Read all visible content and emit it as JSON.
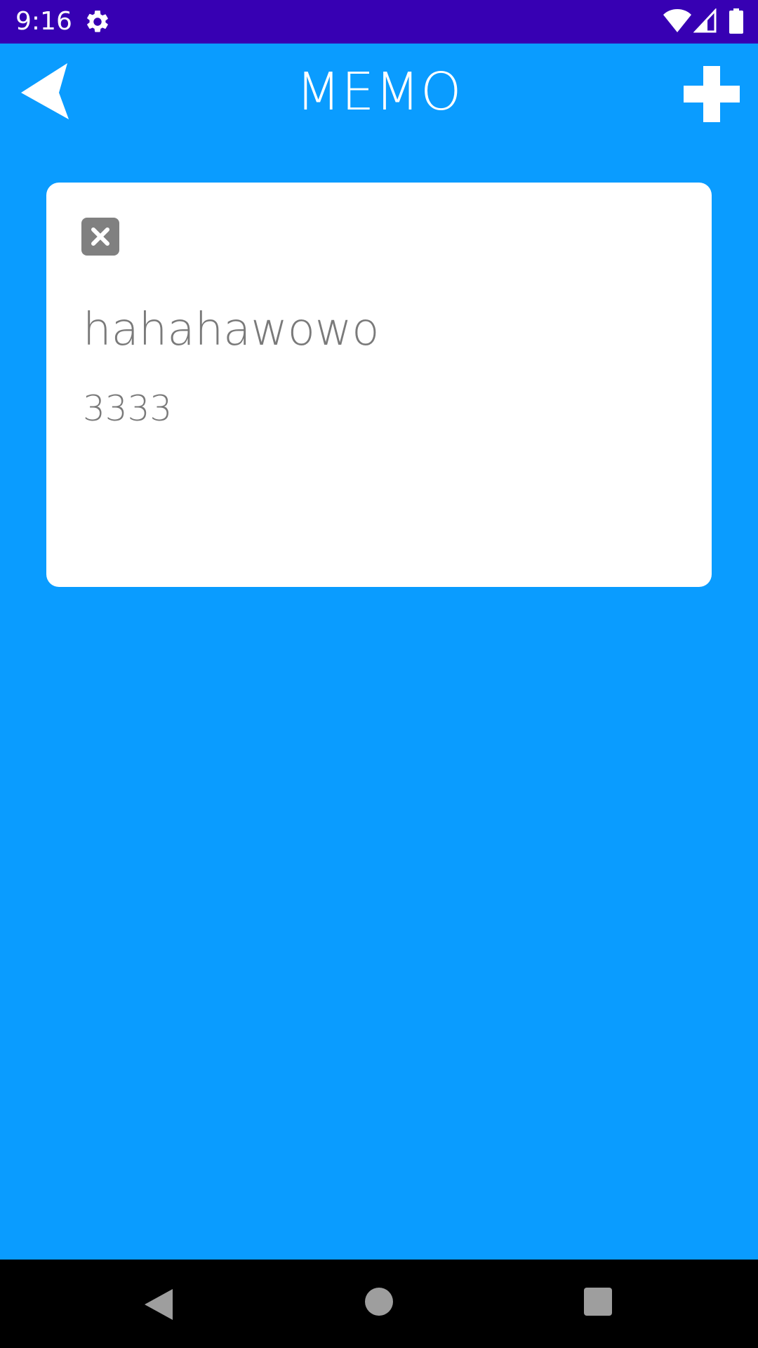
{
  "status_bar": {
    "time": "9:16",
    "icons": [
      "gear-icon",
      "wifi-icon",
      "signal-icon",
      "battery-icon"
    ]
  },
  "app_bar": {
    "title": "MEMO",
    "back_icon": "back-arrow-icon",
    "add_icon": "plus-icon"
  },
  "memos": [
    {
      "title": "hahahawowo",
      "body": "3333",
      "delete_icon": "close-icon"
    }
  ],
  "nav_bar": {
    "icons": [
      "nav-back-icon",
      "nav-home-icon",
      "nav-recents-icon"
    ]
  },
  "colors": {
    "status_bar": "#3700b3",
    "background": "#0a9cff",
    "card": "#ffffff",
    "text_muted": "#7a7a7a",
    "delete_button": "#808080"
  }
}
